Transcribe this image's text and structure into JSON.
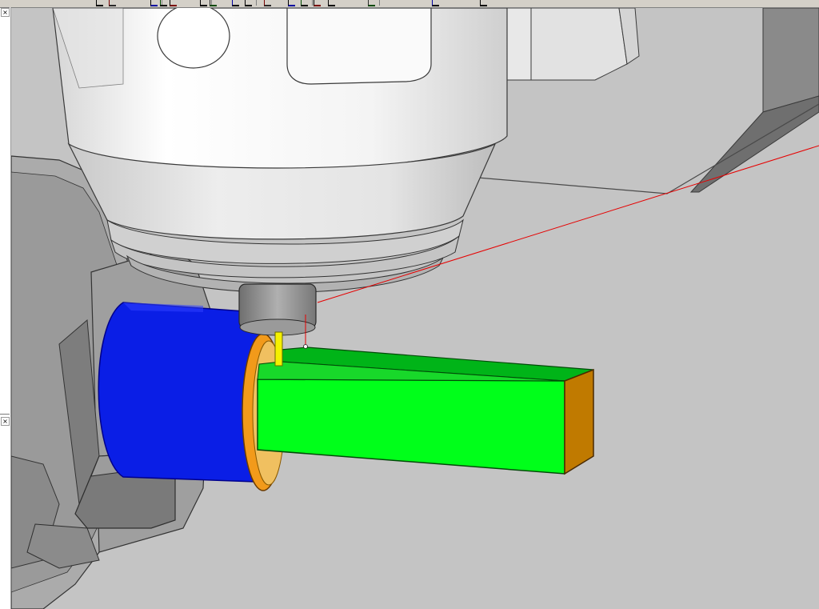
{
  "app": {
    "view": "3d-machining-simulation",
    "toolbar_icons": [
      "new-icon",
      "open-icon",
      "save-icon",
      "undo-icon",
      "redo-icon",
      "zoom-icon",
      "rotate-icon",
      "pan-icon",
      "shade-icon",
      "wire-icon",
      "tool-icon",
      "stock-icon",
      "play-icon",
      "step-icon",
      "stop-icon",
      "view-icon",
      "settings-icon"
    ]
  },
  "left_panel": {
    "pin_top_label": "×",
    "pin_bottom_label": "×"
  },
  "scene": {
    "colors": {
      "background": "#c4c4c4",
      "floor_line": "#4a4a4a",
      "spindle_body": "#f2f2f2",
      "spindle_shadow": "#b8b8b8",
      "chuck": "#a8a8a8",
      "chuck_dark": "#6e6e6e",
      "stock_blue": "#0a1ee6",
      "ring_orange": "#f29a1a",
      "part_green": "#00ff1a",
      "part_green_top": "#00b418",
      "part_end": "#c07a00",
      "tool_yellow": "#f5f000",
      "toolpath_red": "#e60000"
    },
    "objects": [
      "spindle-head",
      "tool-holder",
      "cutting-tool",
      "chuck",
      "chuck-jaw",
      "blue-stock",
      "orange-ring",
      "green-part",
      "toolpath-line",
      "machine-enclosure"
    ]
  }
}
